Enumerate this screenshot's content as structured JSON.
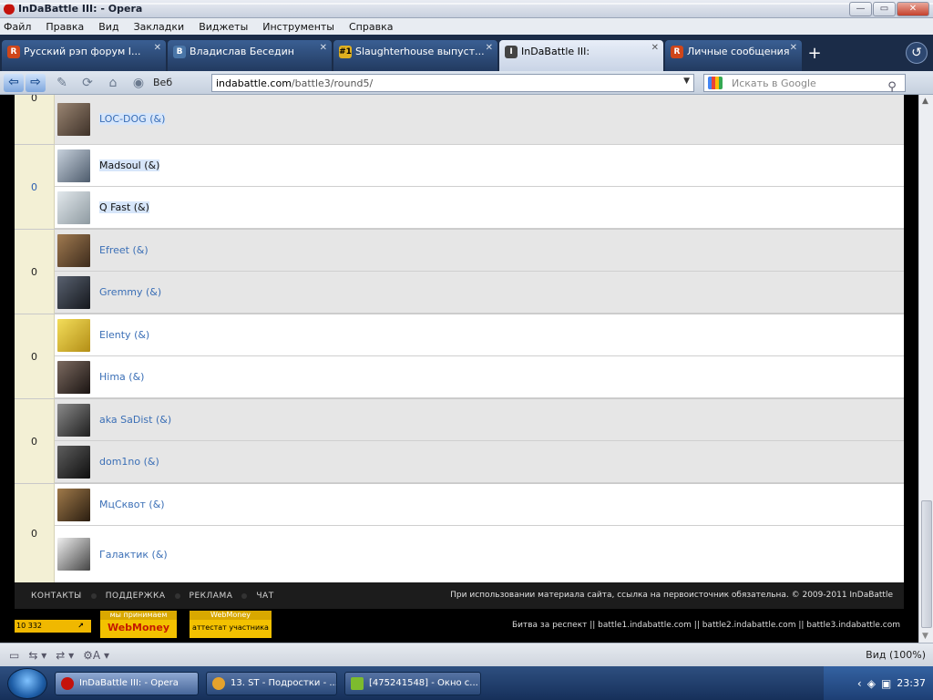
{
  "window": {
    "title": "InDaBattle III: - Opera"
  },
  "menu": [
    "Файл",
    "Правка",
    "Вид",
    "Закладки",
    "Виджеты",
    "Инструменты",
    "Справка"
  ],
  "tabs": [
    {
      "label": "Русский рэп форум I...",
      "icon_color": "#d0461a",
      "icon_text": "R",
      "active": false
    },
    {
      "label": "Владислав Беседин",
      "icon_color": "#4a76a8",
      "icon_text": "В",
      "active": false
    },
    {
      "label": "Slaughterhouse выпуст...",
      "icon_color": "#e0b020",
      "icon_text": "#1",
      "active": false
    },
    {
      "label": "InDaBattle III:",
      "icon_color": "#444",
      "icon_text": "I",
      "active": true
    },
    {
      "label": "Личные сообщения",
      "icon_color": "#d0461a",
      "icon_text": "R",
      "active": false
    }
  ],
  "address": {
    "veb_label": "Веб",
    "host": "indabattle.com",
    "path": "/battle3/round5/",
    "search_placeholder": "Искать в Google"
  },
  "pairs": [
    {
      "votes": "0",
      "votes_blue": false,
      "grey": true,
      "rows": [
        {
          "name": "",
          "dark": false,
          "hl": false,
          "avatar": "#777"
        },
        {
          "name": "LOC-DOG (&)",
          "dark": false,
          "hl": true,
          "avatar": "#5a4a3f"
        }
      ]
    },
    {
      "votes": "0",
      "votes_blue": true,
      "grey": false,
      "rows": [
        {
          "name": "Madsoul (&)",
          "dark": true,
          "hl": true,
          "avatar": "#7b8a9c"
        },
        {
          "name": "Q Fast (&)",
          "dark": true,
          "hl": true,
          "avatar": "#b8c2c8"
        }
      ]
    },
    {
      "votes": "0",
      "votes_blue": false,
      "grey": true,
      "rows": [
        {
          "name": "Efreet (&)",
          "dark": false,
          "hl": false,
          "avatar": "#6d5239"
        },
        {
          "name": "Gremmy (&)",
          "dark": false,
          "hl": false,
          "avatar": "#2b2f36"
        }
      ]
    },
    {
      "votes": "0",
      "votes_blue": false,
      "grey": false,
      "rows": [
        {
          "name": "Elenty (&)",
          "dark": false,
          "hl": false,
          "avatar": "#e0c33a"
        },
        {
          "name": "Hima (&)",
          "dark": false,
          "hl": false,
          "avatar": "#3a3330"
        }
      ]
    },
    {
      "votes": "0",
      "votes_blue": false,
      "grey": true,
      "rows": [
        {
          "name": "aka SaDist (&)",
          "dark": false,
          "hl": false,
          "avatar": "#3c3c3c"
        },
        {
          "name": "dom1no (&)",
          "dark": false,
          "hl": false,
          "avatar": "#2a2a2a"
        }
      ]
    },
    {
      "votes": "0",
      "votes_blue": false,
      "grey": false,
      "rows": [
        {
          "name": "МцСквот (&)",
          "dark": false,
          "hl": false,
          "avatar": "#4a3826"
        },
        {
          "name": "Галактик (&)",
          "dark": false,
          "hl": false,
          "avatar": "#d8d8d8"
        }
      ]
    }
  ],
  "footer": {
    "links": [
      "КОНТАКТЫ",
      "ПОДДЕРЖКА",
      "РЕКЛАМА",
      "ЧАТ"
    ],
    "copyright": "При использовании материала сайта, ссылка на первоисточник обязательна. © 2009-2011 InDaBattle",
    "counter": "10 332",
    "wm1_top": "мы принимаем",
    "wm1_bottom": "WebMoney",
    "wm2_top": "WebMoney",
    "wm2_bottom": "аттестат участника",
    "battles": "Битва за респект || battle1.indabattle.com || battle2.indabattle.com || battle3.indabattle.com"
  },
  "statusbar": {
    "zoom": "Вид (100%)"
  },
  "taskbar": {
    "items": [
      {
        "label": "InDaBattle III: - Opera",
        "color": "#c4120c",
        "active": true
      },
      {
        "label": "13. ST - Подростки - ...",
        "color": "#e5a22c",
        "active": false
      },
      {
        "label": "[475241548] - Окно с...",
        "color": "#7dbb2e",
        "active": false
      }
    ],
    "time": "23:37"
  }
}
